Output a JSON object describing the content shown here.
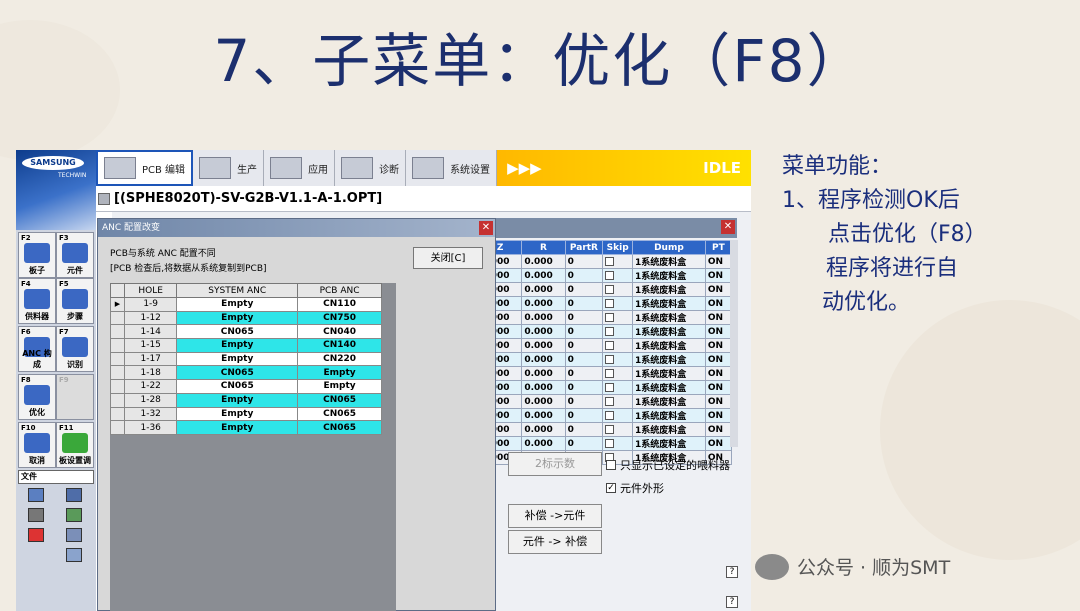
{
  "slide": {
    "title": "7、子菜单：优化（F8）",
    "notes": [
      "菜单功能：",
      "1、程序检测OK后",
      "点击优化（F8）",
      "程序将进行自",
      "动优化。"
    ],
    "watermark": "公众号 · 顺为SMT"
  },
  "app": {
    "logo": "SAMSUNG",
    "logo_sub": "TECHWIN",
    "tabs": [
      {
        "label": "PCB 编辑",
        "icon": "pcb-edit-icon",
        "active": true
      },
      {
        "label": "生产",
        "icon": "production-icon"
      },
      {
        "label": "应用",
        "icon": "apply-icon"
      },
      {
        "label": "诊断",
        "icon": "diagnose-icon"
      },
      {
        "label": "系统设置",
        "icon": "system-settings-icon"
      }
    ],
    "status": {
      "arrows": "▶▶▶",
      "label": "IDLE",
      "color": "#ffc800"
    },
    "path": "[(SPHE8020T)-SV-G2B-V1.1-A-1.OPT]",
    "fkeys": [
      {
        "num": "F2",
        "label": "板子"
      },
      {
        "num": "F3",
        "label": "元件"
      },
      {
        "num": "F4",
        "label": "供料器"
      },
      {
        "num": "F5",
        "label": "步骤"
      },
      {
        "num": "F6",
        "label": "ANC 构成"
      },
      {
        "num": "F7",
        "label": "识别"
      },
      {
        "num": "F8",
        "label": "优化"
      },
      {
        "num": "F9",
        "label": ""
      },
      {
        "num": "F10",
        "label": "取消"
      },
      {
        "num": "F11",
        "label": "板设置调"
      }
    ],
    "file_menu": "文件"
  },
  "grid": {
    "headers": [
      "Z",
      "R",
      "PartR",
      "Skip",
      "Dump",
      "PT"
    ],
    "row": {
      "z": "0.000",
      "r": "0.000",
      "partr": "0",
      "dump": "1系统废料盒",
      "pt": "ON"
    },
    "row_count": 15
  },
  "buttons": {
    "show_count": "2标示数",
    "only_set_feeders": "只显示已设定的喂料器",
    "component_shape": "元件外形",
    "comp_to_feeder": "补偿 ->元件",
    "feeder_to_comp": "元件 -> 补偿",
    "help": "?"
  },
  "anc_dialog": {
    "title": "ANC 配置改变",
    "message_line1": "PCB与系统 ANC 配置不同",
    "message_line2": "[PCB 检查后,将数据从系统复制到PCB]",
    "close_label": "关闭[C]",
    "columns": [
      "HOLE",
      "SYSTEM ANC",
      "PCB ANC"
    ],
    "rows": [
      {
        "hole": "1-9",
        "system": "Empty",
        "pcb": "CN110",
        "hl": false
      },
      {
        "hole": "1-12",
        "system": "Empty",
        "pcb": "CN750",
        "hl": true
      },
      {
        "hole": "1-14",
        "system": "CN065",
        "pcb": "CN040",
        "hl": false
      },
      {
        "hole": "1-15",
        "system": "Empty",
        "pcb": "CN140",
        "hl": true
      },
      {
        "hole": "1-17",
        "system": "Empty",
        "pcb": "CN220",
        "hl": false
      },
      {
        "hole": "1-18",
        "system": "CN065",
        "pcb": "Empty",
        "hl": true
      },
      {
        "hole": "1-22",
        "system": "CN065",
        "pcb": "Empty",
        "hl": false
      },
      {
        "hole": "1-28",
        "system": "Empty",
        "pcb": "CN065",
        "hl": true
      },
      {
        "hole": "1-32",
        "system": "Empty",
        "pcb": "CN065",
        "hl": false
      },
      {
        "hole": "1-36",
        "system": "Empty",
        "pcb": "CN065",
        "hl": true
      }
    ]
  }
}
